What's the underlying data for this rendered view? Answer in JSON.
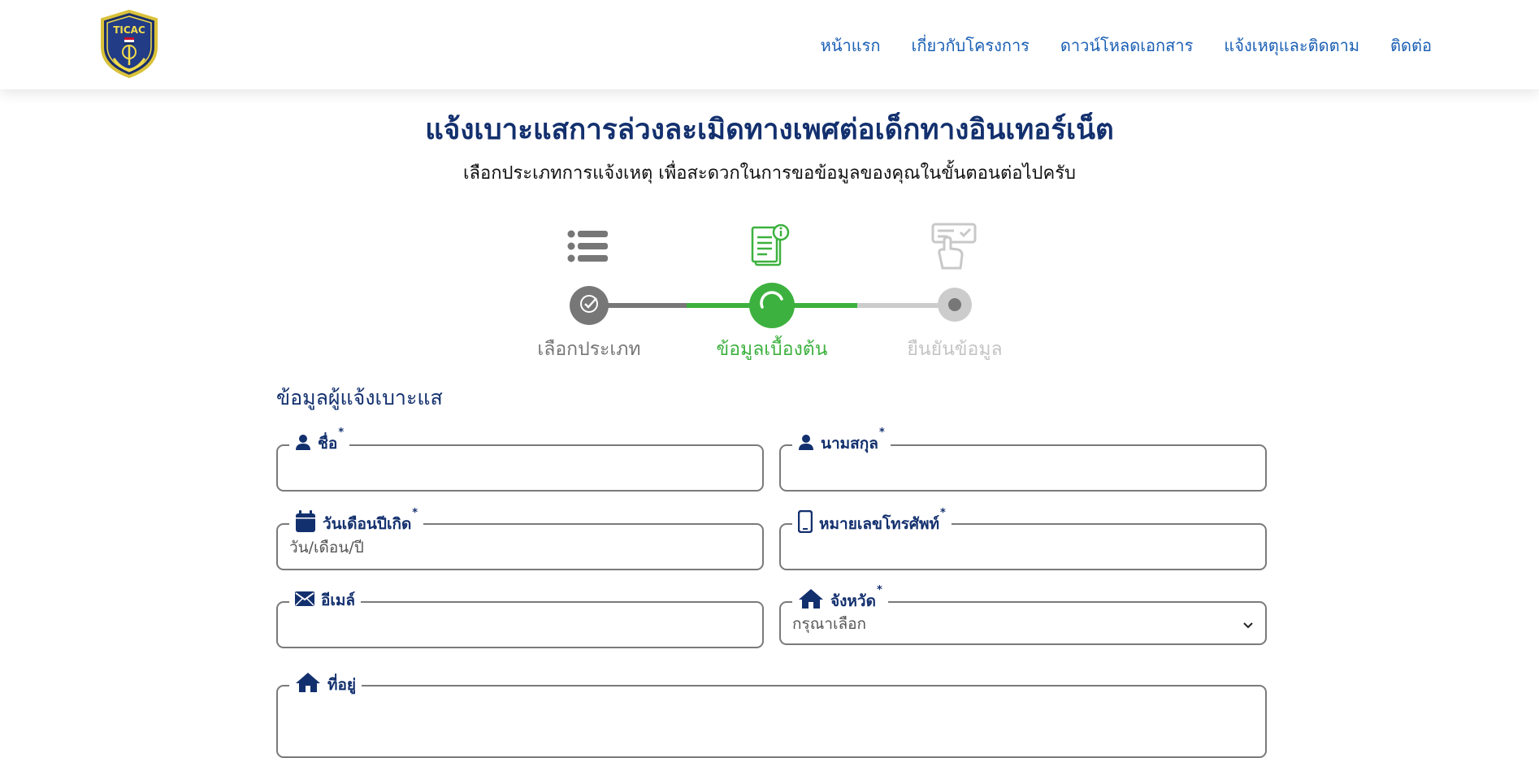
{
  "header": {
    "logo_text": "TICAC",
    "nav": [
      "หน้าแรก",
      "เกี่ยวกับโครงการ",
      "ดาวน์โหลดเอกสาร",
      "แจ้งเหตุและติดตาม",
      "ติดต่อ"
    ]
  },
  "page": {
    "title": "แจ้งเบาะแสการล่วงละเมิดทางเพศต่อเด็กทางอินเทอร์เน็ต",
    "subtitle": "เลือกประเภทการแจ้งเหตุ เพื่อสะดวกในการขอข้อมูลของคุณในขั้นตอนต่อไปครับ"
  },
  "stepper": {
    "steps": [
      {
        "label": "เลือกประเภท",
        "state": "completed",
        "icon": "list-icon"
      },
      {
        "label": "ข้อมูลเบื้องต้น",
        "state": "active",
        "icon": "document-info-icon"
      },
      {
        "label": "ยืนยันข้อมูล",
        "state": "pending",
        "icon": "hand-pointer-form-icon"
      }
    ],
    "colors": {
      "completed": "#777777",
      "active": "#3db13f",
      "pending": "#cccccc"
    }
  },
  "form": {
    "section_title": "ข้อมูลผู้แจ้งเบาะแส",
    "required_mark": "*",
    "fields": {
      "first_name": {
        "label": "ชื่อ",
        "required": true,
        "value": "",
        "placeholder": ""
      },
      "last_name": {
        "label": "นามสกุล",
        "required": true,
        "value": "",
        "placeholder": ""
      },
      "birth_date": {
        "label": "วันเดือนปีเกิด",
        "required": true,
        "value": "",
        "placeholder": "วัน/เดือน/ปี"
      },
      "phone": {
        "label": "หมายเลขโทรศัพท์",
        "required": true,
        "value": "",
        "placeholder": ""
      },
      "email": {
        "label": "อีเมล์",
        "required": false,
        "value": "",
        "placeholder": ""
      },
      "province": {
        "label": "จังหวัด",
        "required": true,
        "selected": "กรุณาเลือก"
      },
      "address": {
        "label": "ที่อยู่",
        "required": false,
        "value": ""
      }
    }
  },
  "colors": {
    "navy": "#13306e",
    "nav_link": "#1a5fb4",
    "green": "#3db13f",
    "border": "#7a7a7a"
  }
}
